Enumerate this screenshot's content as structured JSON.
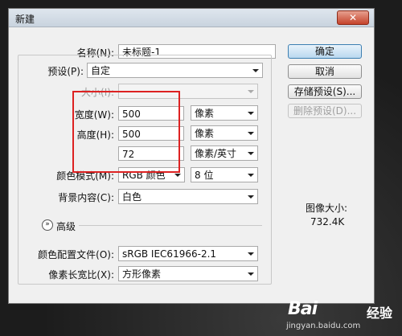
{
  "dialog": {
    "title": "新建",
    "close_glyph": "✕"
  },
  "form": {
    "name_label": "名称(N):",
    "name_value": "未标题-1",
    "preset_label": "预设(P):",
    "preset_value": "自定",
    "size_label": "大小(I):",
    "size_value": "",
    "width_label": "宽度(W):",
    "width_value": "500",
    "width_unit": "像素",
    "height_label": "高度(H):",
    "height_value": "500",
    "height_unit": "像素",
    "resolution_value": "72",
    "resolution_unit": "像素/英寸",
    "color_mode_label": "颜色模式(M):",
    "color_mode_value": "RGB 颜色",
    "bit_depth_value": "8 位",
    "background_label": "背景内容(C):",
    "background_value": "白色",
    "advanced_label": "高级",
    "advanced_glyph": "»",
    "color_profile_label": "颜色配置文件(O):",
    "color_profile_value": "sRGB IEC61966-2.1",
    "pixel_aspect_label": "像素长宽比(X):",
    "pixel_aspect_value": "方形像素"
  },
  "buttons": {
    "ok": "确定",
    "cancel": "取消",
    "save_preset": "存储预设(S)...",
    "delete_preset": "删除预设(D)..."
  },
  "info": {
    "image_size_label": "图像大小:",
    "image_size_value": "732.4K"
  },
  "watermark": {
    "main": "Bai",
    "cn": "经验",
    "sub": "jingyan.baidu.com"
  },
  "colors": {
    "highlight_box": "#dd2222",
    "primary_button": "#bad8ef"
  }
}
